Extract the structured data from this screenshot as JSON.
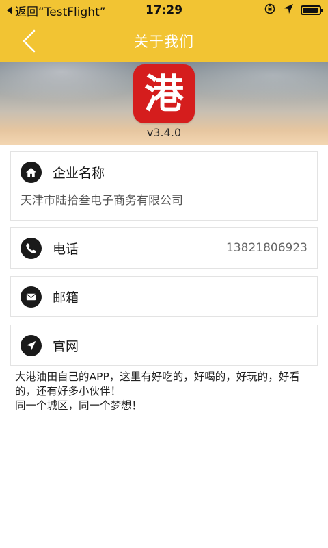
{
  "status_bar": {
    "back_label": "返回“TestFlight”",
    "time": "17:29",
    "battery_level": 0.9
  },
  "nav": {
    "title": "关于我们"
  },
  "app": {
    "logo_char": "港",
    "version": "v3.4.0",
    "logo_color": "#d51d1d"
  },
  "company": {
    "label": "企业名称",
    "value": "天津市陆拾叁电子商务有限公司",
    "icon": "home-icon"
  },
  "phone": {
    "label": "电话",
    "value": "13821806923",
    "icon": "phone-icon"
  },
  "email": {
    "label": "邮箱",
    "icon": "envelope-icon"
  },
  "website": {
    "label": "官网",
    "icon": "location-arrow-icon"
  },
  "about": {
    "text": "大港油田自己的APP，这里有好吃的，好喝的，好玩的，好看的，还有好多小伙伴！\n同一个城区，同一个梦想！"
  },
  "colors": {
    "accent": "#f2c433",
    "title_text": "#ffffff"
  }
}
